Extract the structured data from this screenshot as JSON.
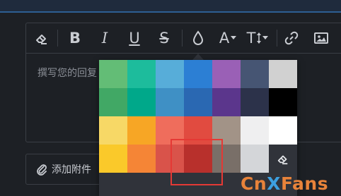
{
  "editor": {
    "placeholder": "撰写您的回复"
  },
  "attach": {
    "label": "添加附件"
  },
  "toolbar": {
    "tools": [
      {
        "name": "clear-format",
        "icon": "eraser-icon"
      },
      {
        "name": "bold",
        "glyph": "B"
      },
      {
        "name": "italic",
        "glyph": "I"
      },
      {
        "name": "underline",
        "glyph": "U"
      },
      {
        "name": "strikethrough",
        "glyph": "S"
      },
      {
        "name": "text-color",
        "icon": "droplet-icon"
      },
      {
        "name": "font-size",
        "glyph": "A"
      },
      {
        "name": "line-height",
        "glyph": "T"
      },
      {
        "name": "link",
        "icon": "link-icon"
      },
      {
        "name": "image",
        "icon": "image-icon"
      }
    ]
  },
  "palette": {
    "rows": [
      [
        "#63bd76",
        "#1dbc9c",
        "#57add9",
        "#2c7fd4",
        "#9a60b6",
        "#465573",
        "#d1d1d1"
      ],
      [
        "#41a865",
        "#00a88a",
        "#3f90c5",
        "#2a68b2",
        "#5b368c",
        "#2c324a",
        "#000000"
      ],
      [
        "#f7d866",
        "#f7a625",
        "#ef6d5c",
        "#e14b40",
        "#a29387",
        "#efeff0",
        "#ffffff"
      ],
      [
        "#fac92a",
        "#f58536",
        "#d9534a",
        "#b8302c",
        "#796f68",
        "#d4d6d9",
        null
      ]
    ],
    "clear_icon": "eraser-icon",
    "highlighted_color": "#b8302c"
  },
  "watermark": {
    "part1": "Cn",
    "part2": "X",
    "part3": "Fans"
  }
}
